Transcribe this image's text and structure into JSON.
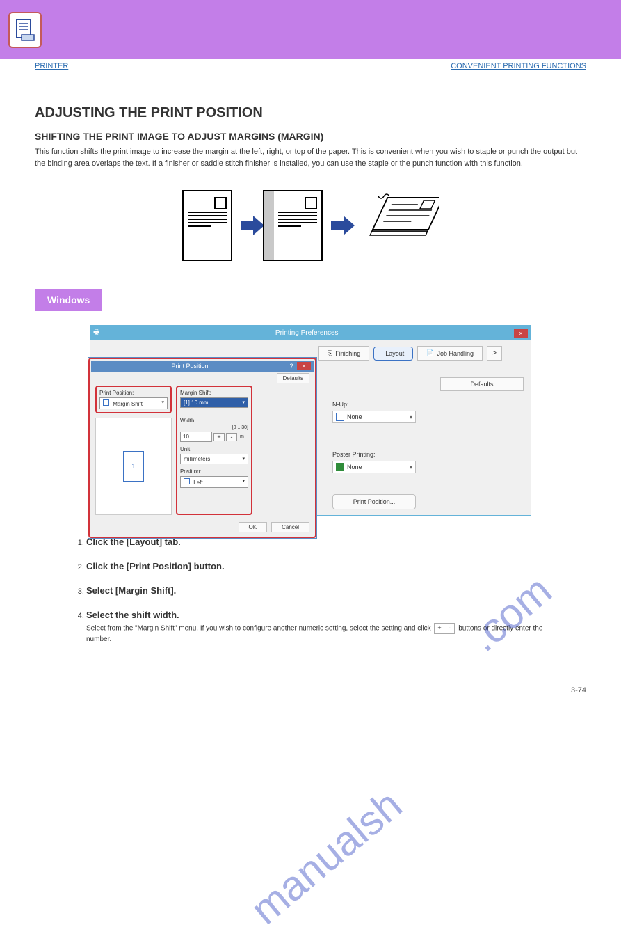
{
  "breadcrumb_left": "PRINTER",
  "breadcrumb_right": "CONVENIENT PRINTING FUNCTIONS",
  "heading": "ADJUSTING THE PRINT POSITION",
  "margin_shift_heading": "SHIFTING THE PRINT IMAGE TO ADJUST MARGINS (MARGIN)",
  "intro_para": "This function shifts the print image to increase the margin at the left, right, or top of the paper. This is convenient when you wish to staple or punch the output but the binding area overlaps the text. If a finisher or saddle stitch finisher is installed, you can use the staple or the punch function with this function.",
  "section_tag": "Windows",
  "pref_window": {
    "title": "Printing Preferences",
    "tabs": {
      "finishing": "Finishing",
      "layout": "Layout",
      "job_handling": "Job Handling",
      "next": ">"
    },
    "defaults_btn": "Defaults",
    "nup_label": "N-Up:",
    "nup_value": "None",
    "poster_label": "Poster Printing:",
    "poster_value": "None",
    "print_pos_btn": "Print Position..."
  },
  "modal": {
    "title": "Print Position",
    "help": "?",
    "defaults": "Defaults",
    "print_position_label": "Print Position:",
    "print_position_value": "Margin Shift",
    "preview_number": "1",
    "margin_shift_label": "Margin Shift:",
    "margin_shift_value": "[1] 10 mm",
    "width_label": "Width:",
    "width_range": "[0 .. 30]",
    "width_value": "10",
    "unit_label": "Unit:",
    "unit_value": "millimeters",
    "position_label": "Position:",
    "position_value": "Left",
    "ok": "OK",
    "cancel": "Cancel"
  },
  "steps": [
    {
      "title": "Click the [Layout] tab.",
      "body": ""
    },
    {
      "title": "Click the [Print Position] button.",
      "body": ""
    },
    {
      "title": "Select [Margin Shift].",
      "body": ""
    },
    {
      "title": "Select the shift width.",
      "body_prefix": "Select from the \"Margin Shift\" menu. If you wish to configure another numeric setting, select the setting and click ",
      "body_suffix": " buttons or directly enter the number."
    }
  ],
  "plus": "+",
  "minus": "-",
  "page_number": "3-74",
  "watermark": "manualshive.com"
}
